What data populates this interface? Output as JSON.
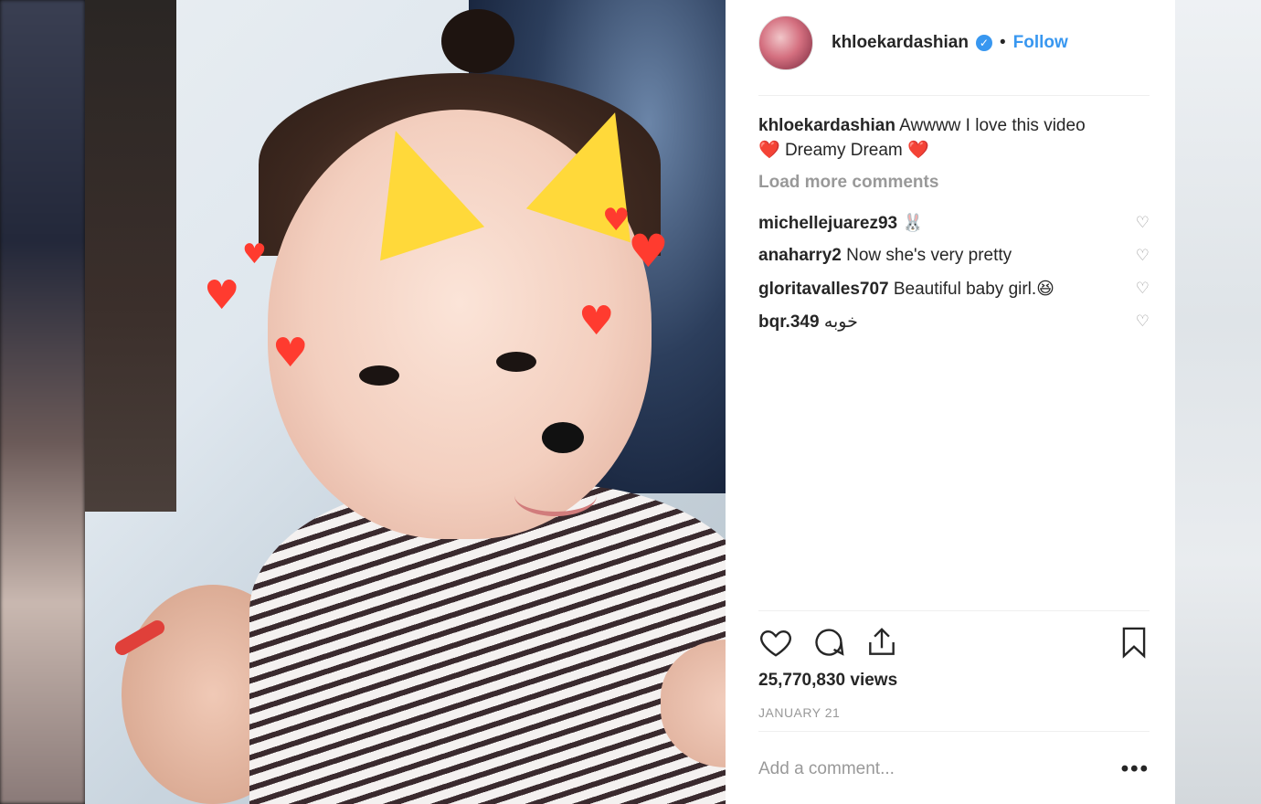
{
  "post": {
    "username": "khloekardashian",
    "verified_icon": "verified-badge-icon",
    "separator": "•",
    "follow_label": "Follow"
  },
  "caption": {
    "username": "khloekardashian",
    "text_before": " Awwww I love this video",
    "heart1": "❤️",
    "text_middle": " Dreamy Dream ",
    "heart2": "❤️"
  },
  "load_more_label": "Load more comments",
  "comments": [
    {
      "username": "michellejuarez93",
      "text": " 🐰"
    },
    {
      "username": "anaharry2",
      "text": " Now she's very pretty"
    },
    {
      "username": "gloritavalles707",
      "text": " Beautiful baby girl.😆"
    },
    {
      "username": "bqr.349",
      "text": " خوبه"
    }
  ],
  "stats": {
    "views": "25,770,830 views",
    "date": "JANUARY 21"
  },
  "comment_box": {
    "placeholder": "Add a comment...",
    "more": "•••"
  },
  "icons": {
    "like": "heart-icon",
    "comment": "comment-bubble-icon",
    "share": "share-icon",
    "save": "bookmark-icon",
    "comment_like": "heart-outline-icon"
  },
  "colors": {
    "accent": "#3897f0",
    "text": "#262626",
    "muted": "#999999",
    "divider": "#efefef"
  }
}
